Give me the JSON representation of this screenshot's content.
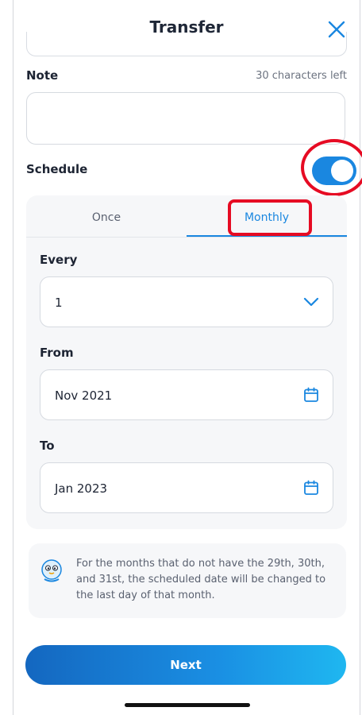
{
  "header": {
    "title": "Transfer"
  },
  "note": {
    "label": "Note",
    "counter": "30 characters left",
    "value": ""
  },
  "schedule": {
    "label": "Schedule",
    "enabled": true
  },
  "tabs": [
    {
      "label": "Once",
      "active": false
    },
    {
      "label": "Monthly",
      "active": true
    }
  ],
  "every": {
    "label": "Every",
    "value": "1"
  },
  "from": {
    "label": "From",
    "value": "Nov 2021"
  },
  "to": {
    "label": "To",
    "value": "Jan 2023"
  },
  "info": {
    "text": "For the months that do not have the 29th, 30th, and 31st, the scheduled date will be changed to the last day of that month."
  },
  "actions": {
    "next_label": "Next"
  },
  "colors": {
    "accent": "#1a87e0",
    "highlight": "#e60b23"
  },
  "icons": {
    "close": "close-icon",
    "dropdown": "chevron-down-icon",
    "calendar": "calendar-icon",
    "info": "mascot-icon"
  }
}
